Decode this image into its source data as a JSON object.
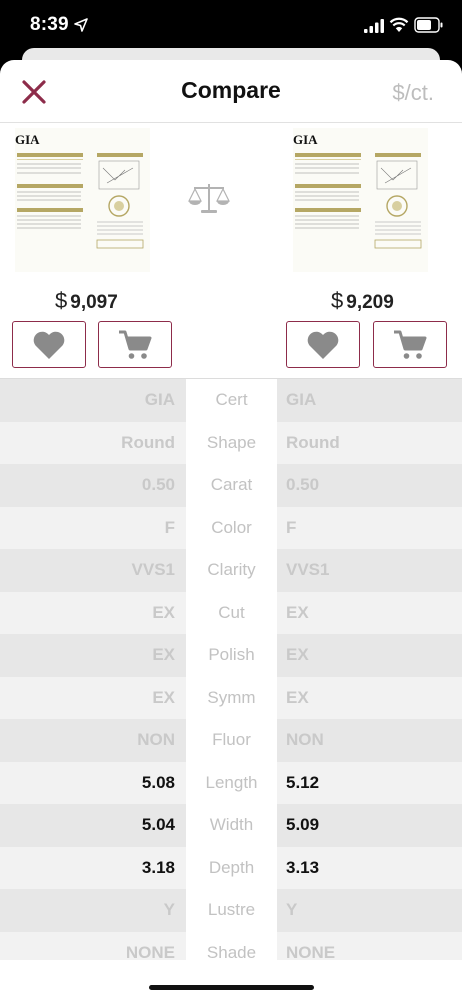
{
  "status_bar": {
    "time": "8:39"
  },
  "header": {
    "close_icon": "close-icon",
    "title": "Compare",
    "unit_toggle": "$/ct."
  },
  "diamonds": [
    {
      "price_currency": "$",
      "price": "9,097",
      "cert_logo": "GIA"
    },
    {
      "price_currency": "$",
      "price": "9,209",
      "cert_logo": "GIA"
    }
  ],
  "actions": {
    "favorite_icon": "heart-icon",
    "cart_icon": "cart-icon"
  },
  "compare_icon": "scale-icon",
  "colors": {
    "accent": "#8d2c4a",
    "icon_gray": "#8a8a8a"
  },
  "rows": [
    {
      "label": "Cert",
      "left": "GIA",
      "right": "GIA"
    },
    {
      "label": "Shape",
      "left": "Round",
      "right": "Round"
    },
    {
      "label": "Carat",
      "left": "0.50",
      "right": "0.50"
    },
    {
      "label": "Color",
      "left": "F",
      "right": "F"
    },
    {
      "label": "Clarity",
      "left": "VVS1",
      "right": "VVS1"
    },
    {
      "label": "Cut",
      "left": "EX",
      "right": "EX"
    },
    {
      "label": "Polish",
      "left": "EX",
      "right": "EX"
    },
    {
      "label": "Symm",
      "left": "EX",
      "right": "EX"
    },
    {
      "label": "Fluor",
      "left": "NON",
      "right": "NON"
    },
    {
      "label": "Length",
      "left": "5.08",
      "right": "5.12"
    },
    {
      "label": "Width",
      "left": "5.04",
      "right": "5.09"
    },
    {
      "label": "Depth",
      "left": "3.18",
      "right": "3.13"
    },
    {
      "label": "Lustre",
      "left": "Y",
      "right": "Y"
    },
    {
      "label": "Shade",
      "left": "NONE",
      "right": "NONE"
    }
  ]
}
